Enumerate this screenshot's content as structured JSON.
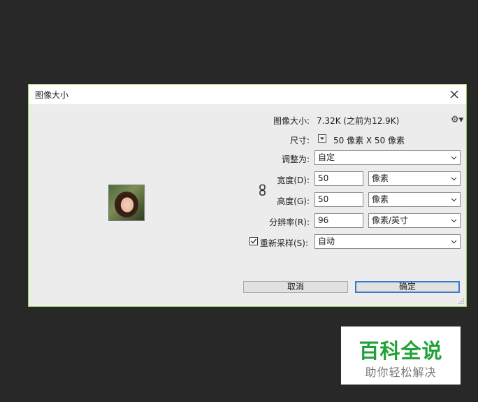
{
  "dialog": {
    "title": "图像大小",
    "image_size_label": "图像大小:",
    "image_size_value": "7.32K (之前为12.9K)",
    "dimensions_label": "尺寸:",
    "dimensions_value": "50 像素  X  50 像素",
    "fit_to_label": "调整为:",
    "fit_to_value": "自定",
    "width_label": "宽度(D):",
    "width_value": "50",
    "width_unit": "像素",
    "height_label": "高度(G):",
    "height_value": "50",
    "height_unit": "像素",
    "resolution_label": "分辨率(R):",
    "resolution_value": "96",
    "resolution_unit": "像素/英寸",
    "resample_label": "重新采样(S):",
    "resample_checked": true,
    "resample_value": "自动",
    "cancel_label": "取消",
    "ok_label": "确定",
    "gear_icon": "gear-icon"
  },
  "watermark": {
    "main": "百科全说",
    "sub": "助你轻松解决"
  },
  "colors": {
    "background": "#282828",
    "dialog_bg": "#ececec",
    "dialog_border": "#9acd55",
    "primary_button_border": "#3b79d1",
    "logo_green": "#1fa238"
  }
}
